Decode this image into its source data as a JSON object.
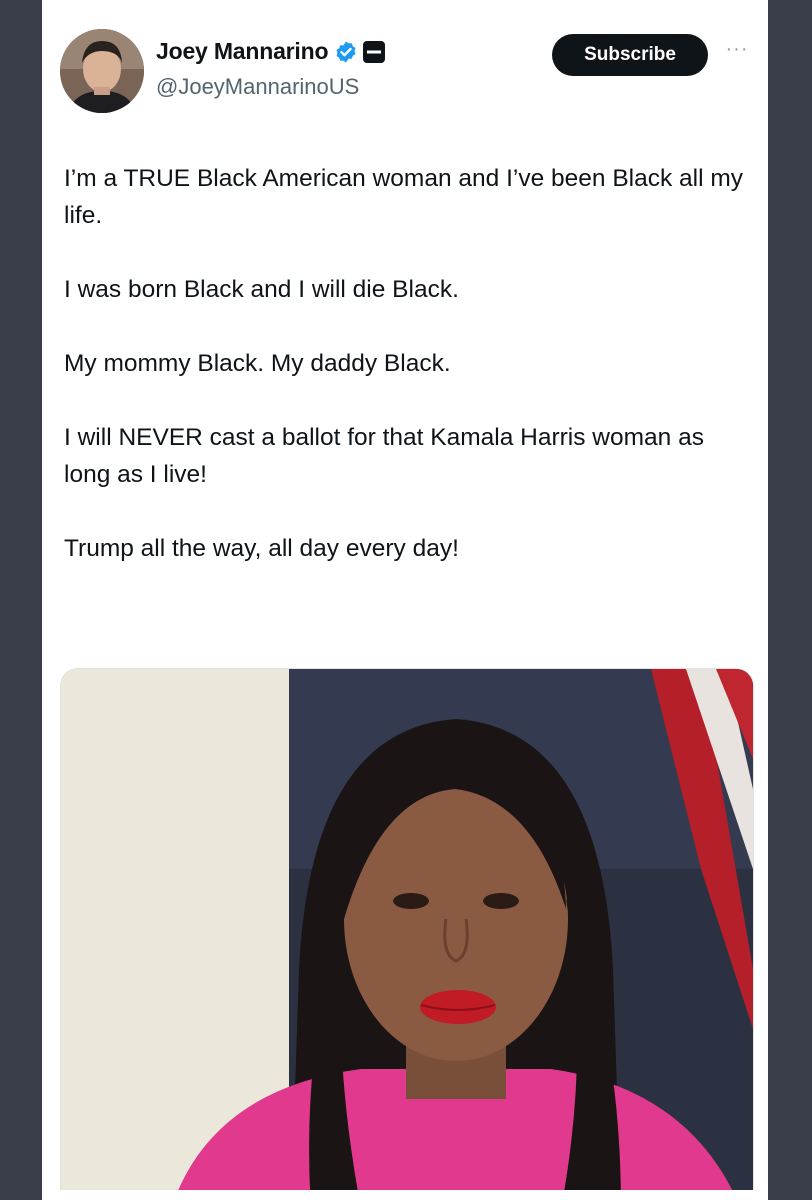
{
  "author": {
    "name": "Joey Mannarino",
    "handle": "@JoeyMannarinoUS"
  },
  "subscribe_label": "Subscribe",
  "more_label": "···",
  "tweet": {
    "paragraphs": [
      "I’m a TRUE Black American woman and I’ve been Black all my life.",
      "I was born Black and I will die Black.",
      "My mommy Black. My daddy Black.",
      "I will NEVER cast a ballot for that Kamala Harris woman as long as I live!",
      "Trump all the way, all day every day!"
    ]
  },
  "icons": {
    "verified": "verified-badge-icon",
    "org": "affiliate-badge-icon",
    "more": "more-options-icon"
  },
  "colors": {
    "accent": "#1d9bf0",
    "text": "#0f1419",
    "secondary": "#536471",
    "button": "#0f1419"
  }
}
